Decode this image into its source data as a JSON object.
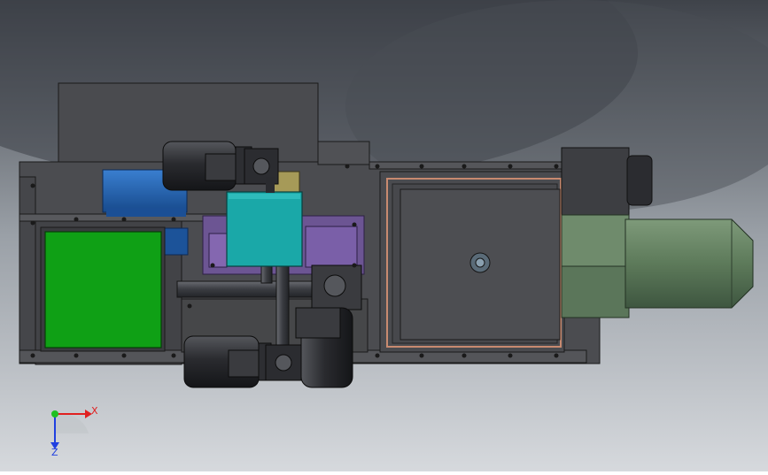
{
  "triad": {
    "x_label": "X",
    "z_label": "Z",
    "colors": {
      "x": "#e02020",
      "y": "#20c020",
      "z": "#2040e0"
    }
  },
  "colors": {
    "frame": "#4a4b4f",
    "motor": "#2e2f33",
    "green_panel": "#0fa015",
    "cyan_box": "#1aa8a8",
    "blue_part": "#1f5fb0",
    "purple_plate": "#7a5aa8",
    "sage_cylinder": "#5f7a5c",
    "khaki_part": "#a69a58",
    "copper_trim": "#c88a70"
  }
}
